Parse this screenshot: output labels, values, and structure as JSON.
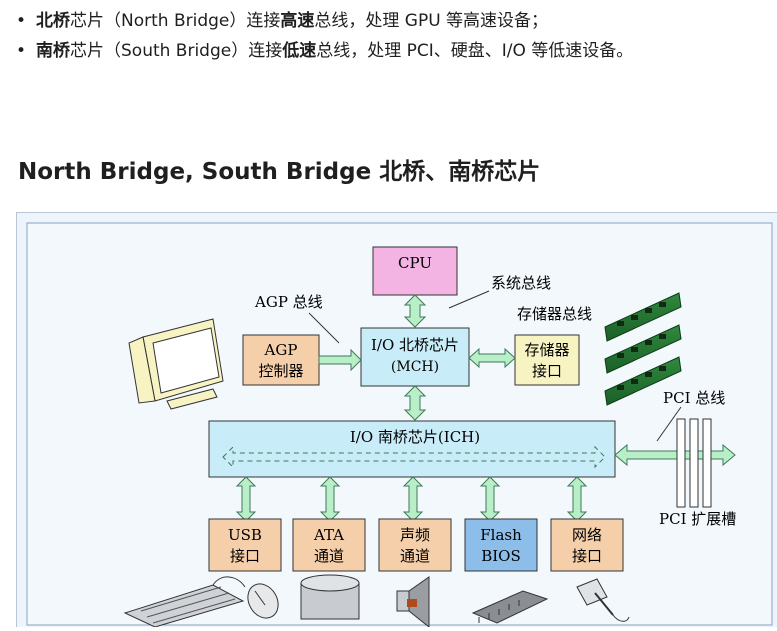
{
  "bullets": [
    {
      "bold": "北桥",
      "rest": "芯片（North Bridge）连接",
      "bold2": "高速",
      "rest2": "总线，处理 GPU 等高速设备；"
    },
    {
      "bold": "南桥",
      "rest": "芯片（South Bridge）连接",
      "bold2": "低速",
      "rest2": "总线，处理 PCI、硬盘、I/O 等低速设备。"
    }
  ],
  "heading": "North Bridge, South Bridge 北桥、南桥芯片",
  "diagram": {
    "cpu": "CPU",
    "system_bus": "系统总线",
    "agp_bus": "AGP 总线",
    "memory_bus": "存储器总线",
    "agp_controller": [
      "AGP",
      "控制器"
    ],
    "north_bridge": [
      "I/O 北桥芯片",
      "(MCH)"
    ],
    "memory_interface": [
      "存储器",
      "接口"
    ],
    "south_bridge": "I/O 南桥芯片(ICH)",
    "pci_bus": "PCI 总线",
    "pci_slots": "PCI 扩展槽",
    "devices": [
      {
        "line1": "USB",
        "line2": "接口"
      },
      {
        "line1": "ATA",
        "line2": "通道"
      },
      {
        "line1": "声频",
        "line2": "通道"
      },
      {
        "line1": "Flash",
        "line2": "BIOS"
      },
      {
        "line1": "网络",
        "line2": "接口"
      }
    ]
  },
  "colors": {
    "box_blue": "#c9ecf9",
    "box_orange": "#f5cfa9",
    "box_pink": "#f3b4e3",
    "box_yellow": "#f7f3c2",
    "box_flash": "#8dbde9",
    "arrow_green": "#b9efc8",
    "arrow_stroke": "#3d7a55"
  }
}
